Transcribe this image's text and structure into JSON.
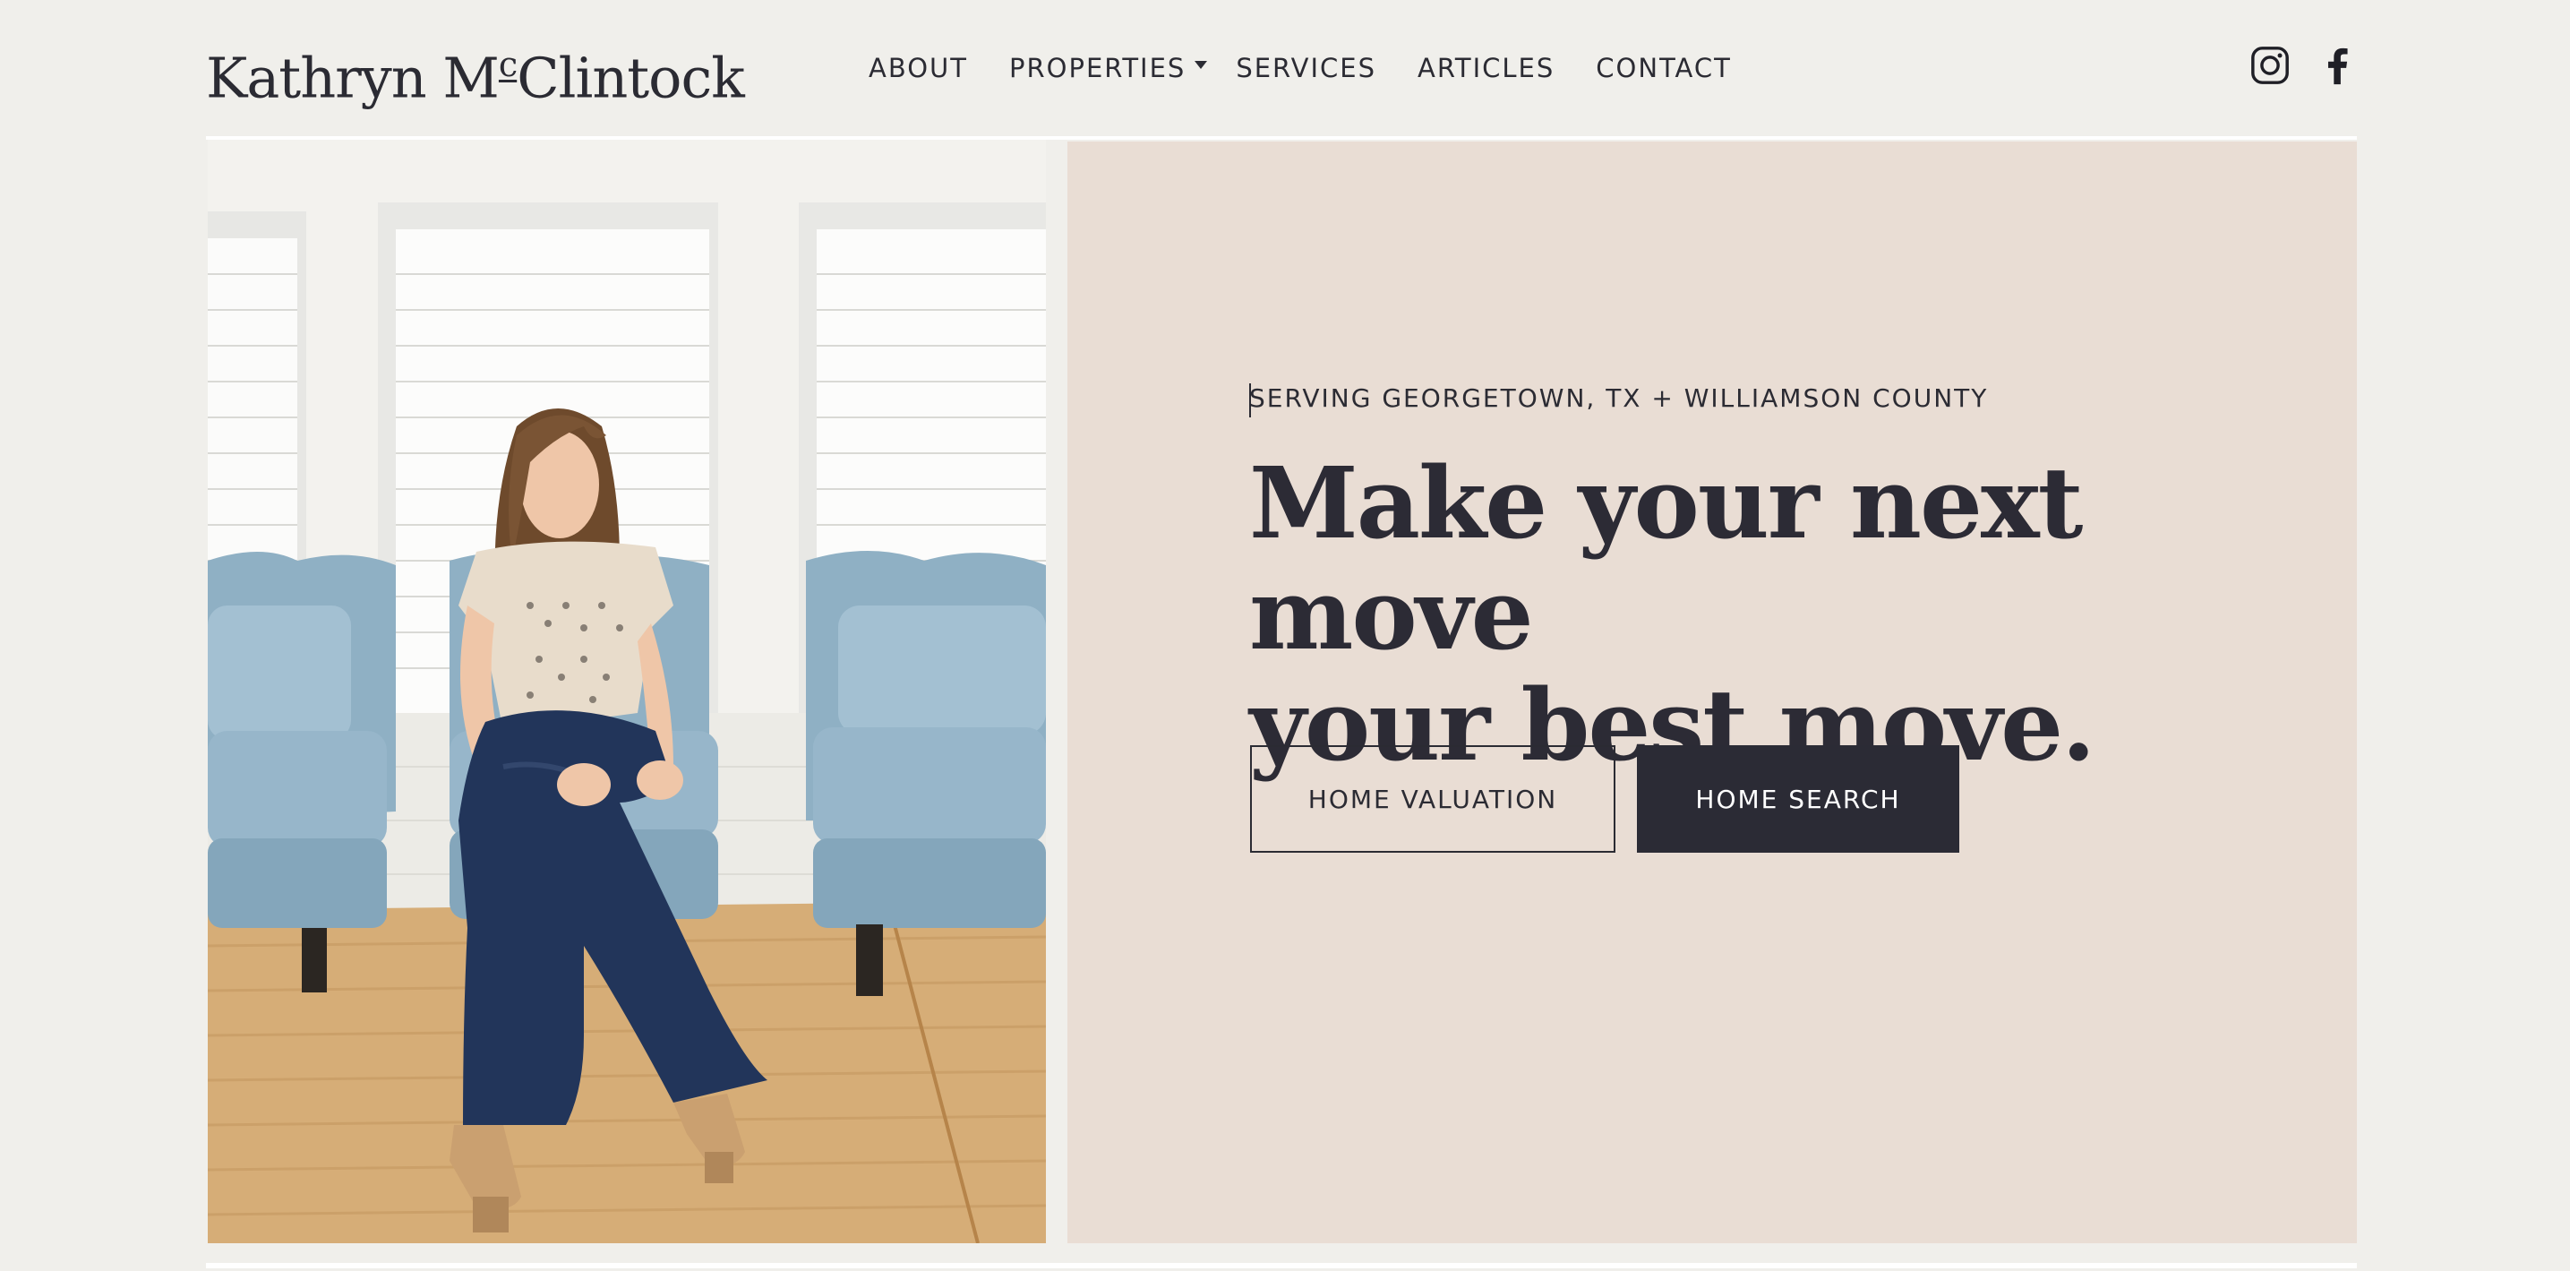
{
  "brand": {
    "logo_prefix": "Kathryn M",
    "logo_sup": "c",
    "logo_suffix": "Clintock"
  },
  "nav": {
    "items": [
      {
        "label": "ABOUT"
      },
      {
        "label": "PROPERTIES",
        "has_dropdown": true
      },
      {
        "label": "SERVICES"
      },
      {
        "label": "ARTICLES"
      },
      {
        "label": "CONTACT"
      }
    ]
  },
  "social": {
    "icons": [
      "instagram-icon",
      "facebook-icon"
    ]
  },
  "hero": {
    "eyebrow": "SERVING GEORGETOWN, TX + WILLIAMSON COUNTY",
    "headline_line1": "Make your next move",
    "headline_line2": "your best move.",
    "buttons": {
      "valuation": "HOME VALUATION",
      "search": "HOME SEARCH"
    },
    "photo_alt": "Kathryn McClintock seated between blue armchairs"
  },
  "colors": {
    "background": "#f0efeb",
    "panel": "#e9ddd4",
    "ink": "#2b2b33",
    "button_dark": "#2b2b35",
    "chair_blue": "#8fb0c4"
  }
}
